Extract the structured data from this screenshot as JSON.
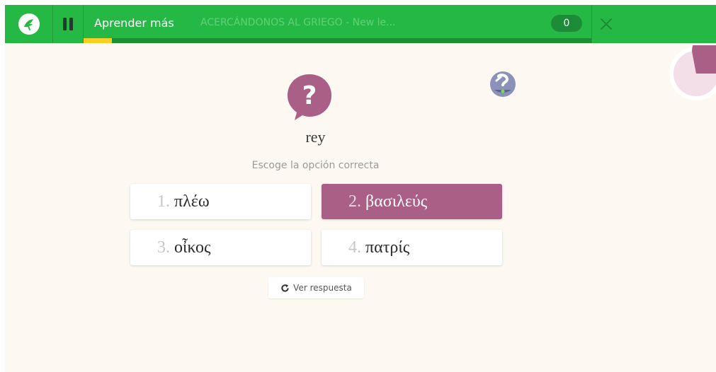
{
  "header": {
    "learn_label": "Aprender más",
    "course_title": "ACERCÁNDONOS AL GRIEGO - New le...",
    "score": "0",
    "logo_icon": "memrise-logo-icon",
    "pause_icon": "pause-icon",
    "close_icon": "close-icon",
    "progress": 0.056,
    "colors": {
      "bar": "#26b844",
      "progress": "#f7d023",
      "accent": "#a95f86"
    }
  },
  "timer": {
    "remaining_fraction": 0.72,
    "icon": "timer-pie-icon"
  },
  "question": {
    "icon": "question-bubble-icon",
    "hint_icon": "hint-icon",
    "prompt": "rey",
    "instruction": "Escoge la opción correcta"
  },
  "options": [
    {
      "num": "1.",
      "text": "πλέω",
      "selected": false
    },
    {
      "num": "2.",
      "text": "βασιλεύς",
      "selected": true
    },
    {
      "num": "3.",
      "text": "οἶκος",
      "selected": false
    },
    {
      "num": "4.",
      "text": "πατρίς",
      "selected": false
    }
  ],
  "reveal": {
    "label": "Ver respuesta",
    "icon": "refresh-icon"
  }
}
